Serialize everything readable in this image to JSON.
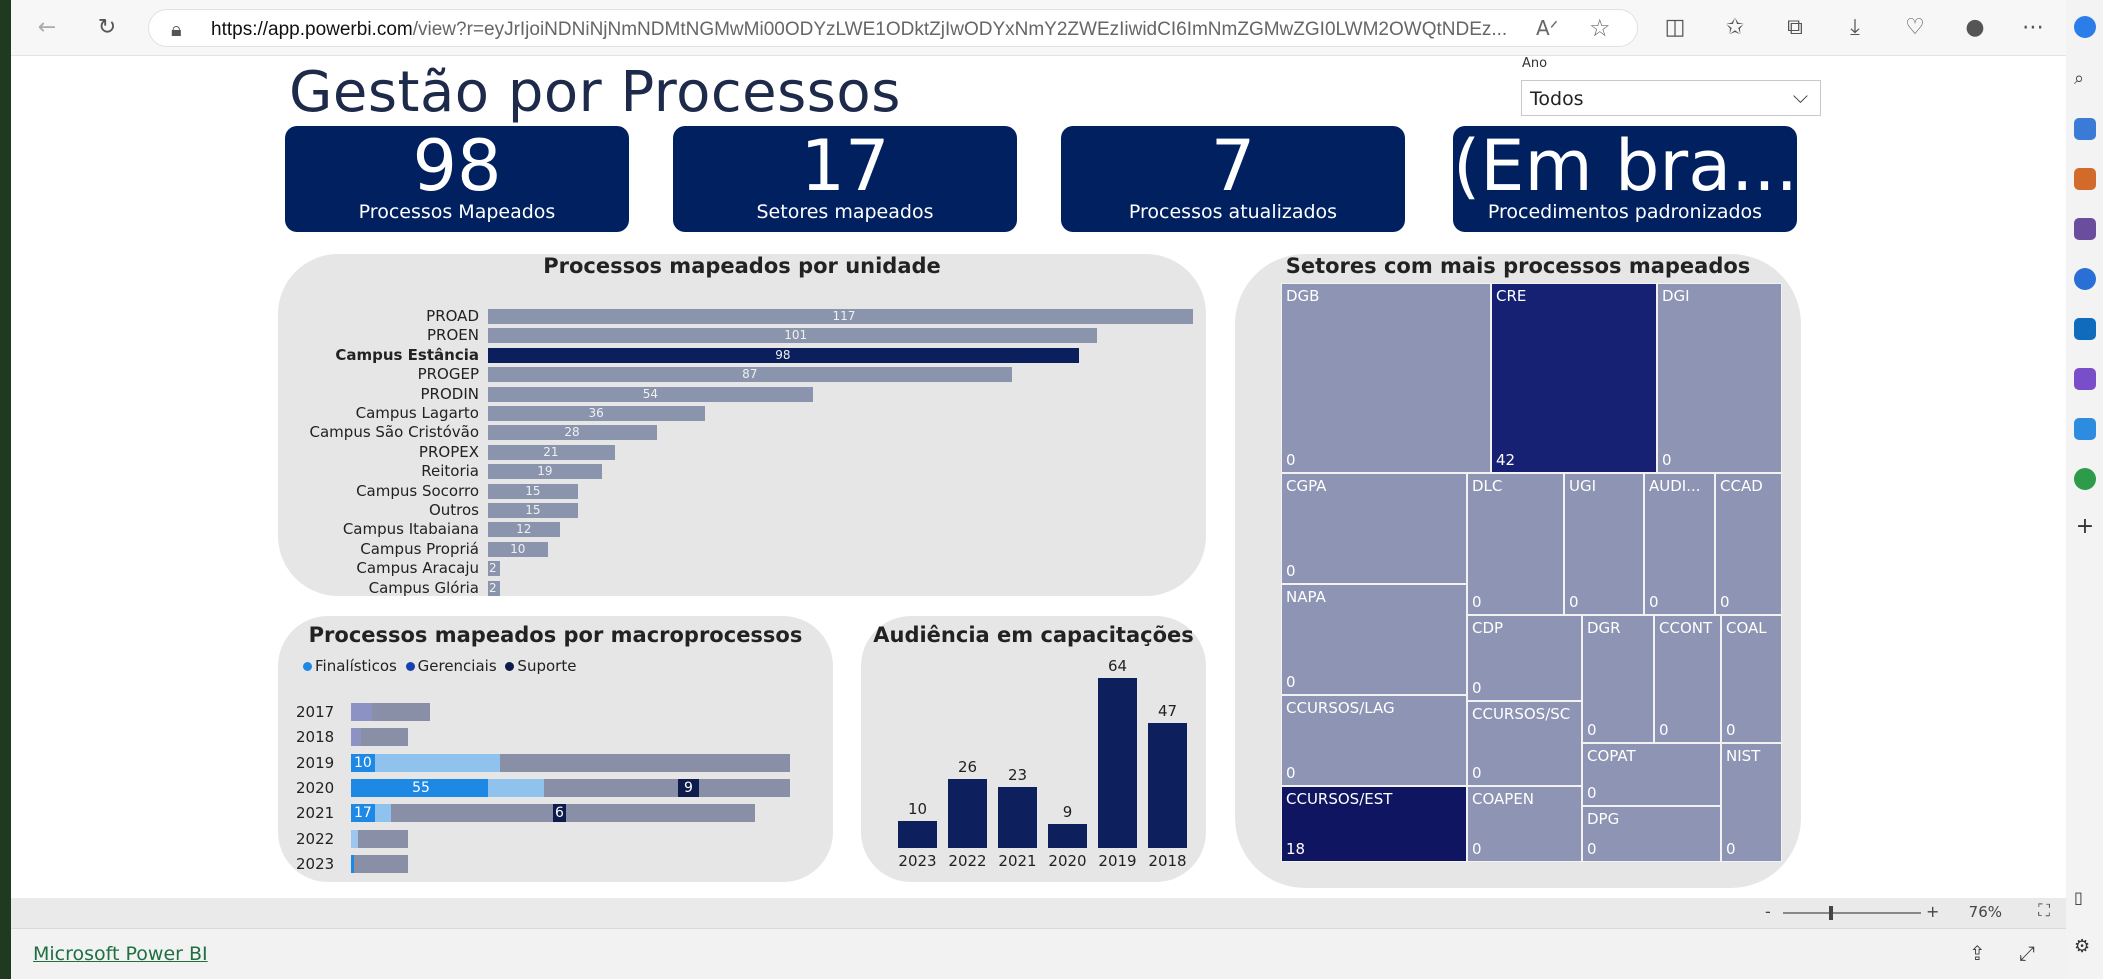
{
  "browser": {
    "url_host": "https://app.powerbi.com",
    "url_rest": "/view?r=eyJrIjoiNDNiNjNmNDMtNGMwMi00ODYzLWE1ODktZjIwODYxNmY2ZWEzIiwidCI6ImNmZGMwZGI0LWM2OWQtNDEz...",
    "read_aloud": "A",
    "star": "☆"
  },
  "report": {
    "title": "Gestão por Processos",
    "slicer": {
      "label": "Ano",
      "value": "Todos"
    },
    "kpis": [
      {
        "value": "98",
        "label": "Processos Mapeados"
      },
      {
        "value": "17",
        "label": "Setores mapeados"
      },
      {
        "value": "7",
        "label": "Processos atualizados"
      },
      {
        "value": "(Em bra...",
        "label": "Procedimentos padronizados"
      }
    ],
    "unidade_title": "Processos mapeados por unidade",
    "setores_title": "Setores com mais processos mapeados",
    "macro_title": "Processos mapeados por macroprocessos",
    "audiencia_title": "Audiência em capacitações"
  },
  "chart_data": [
    {
      "type": "bar",
      "orientation": "horizontal",
      "title": "Processos mapeados por unidade",
      "categories": [
        "PROAD",
        "PROEN",
        "Campus Estância",
        "PROGEP",
        "PRODIN",
        "Campus Lagarto",
        "Campus São Cristóvão",
        "PROPEX",
        "Reitoria",
        "Campus Socorro",
        "Outros",
        "Campus Itabaiana",
        "Campus Propriá",
        "Campus Aracaju",
        "Campus Glória"
      ],
      "values": [
        117,
        101,
        98,
        87,
        54,
        36,
        28,
        21,
        19,
        15,
        15,
        12,
        10,
        2,
        2
      ],
      "highlighted": "Campus Estância",
      "colors": {
        "default": "#8a94ad",
        "highlight": "#0a1f5c"
      }
    },
    {
      "type": "treemap",
      "title": "Setores com mais processos mapeados",
      "items": [
        {
          "name": "DGB",
          "value": "0"
        },
        {
          "name": "CRE",
          "value": "42"
        },
        {
          "name": "DGI",
          "value": "0"
        },
        {
          "name": "CGPA",
          "value": "0"
        },
        {
          "name": "DLC",
          "value": "0"
        },
        {
          "name": "UGI",
          "value": "0"
        },
        {
          "name": "AUDI...",
          "value": "0"
        },
        {
          "name": "CCAD",
          "value": "0"
        },
        {
          "name": "NAPA",
          "value": "0"
        },
        {
          "name": "CDP",
          "value": "0"
        },
        {
          "name": "DGR",
          "value": "0"
        },
        {
          "name": "CCONT",
          "value": "0"
        },
        {
          "name": "COAL",
          "value": "0"
        },
        {
          "name": "CCURSOS/LAG",
          "value": "0"
        },
        {
          "name": "CCURSOS/SC",
          "value": "0"
        },
        {
          "name": "COPAT",
          "value": "0"
        },
        {
          "name": "NIST",
          "value": "0"
        },
        {
          "name": "DPG",
          "value": "0"
        },
        {
          "name": "CCURSOS/EST",
          "value": "18"
        },
        {
          "name": "COAPEN",
          "value": "0"
        }
      ]
    },
    {
      "type": "bar",
      "orientation": "horizontal",
      "stacked": true,
      "title": "Processos mapeados por macroprocessos",
      "legend": [
        "Finalísticos",
        "Gerenciais",
        "Suporte"
      ],
      "legend_colors": [
        "#1e88e5",
        "#1a3fb0",
        "#0d1b4d"
      ],
      "categories": [
        "2017",
        "2018",
        "2019",
        "2020",
        "2021",
        "2022",
        "2023"
      ],
      "highlight_fractions": [
        0.27,
        0.18,
        0.34,
        0.44,
        0.1,
        0.12,
        0.03
      ],
      "total_fractions": [
        0.18,
        0.13,
        1.0,
        1.0,
        0.92,
        0.13,
        0.13
      ],
      "labels": {
        "2019": [
          "10"
        ],
        "2020": [
          "55",
          "9"
        ],
        "2021": [
          "17",
          "6"
        ]
      }
    },
    {
      "type": "bar",
      "title": "Audiência em capacitações",
      "categories": [
        "2023",
        "2022",
        "2021",
        "2020",
        "2019",
        "2018"
      ],
      "values": [
        10,
        26,
        23,
        9,
        64,
        47
      ],
      "color": "#0d1f5c"
    }
  ],
  "status": {
    "zoom": "76%",
    "zoom_minus": "-",
    "zoom_plus": "+"
  },
  "footer": {
    "link": "Microsoft Power BI"
  }
}
